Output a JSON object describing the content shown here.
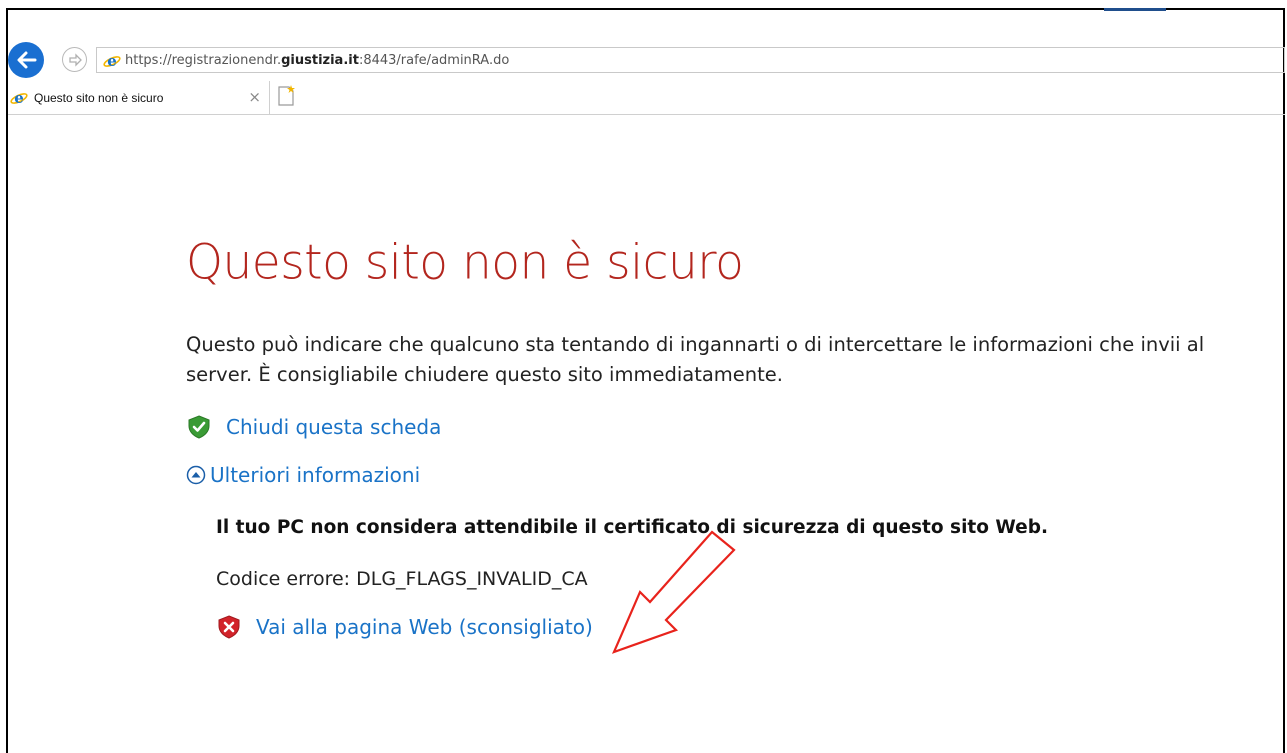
{
  "browser": {
    "address_url_prefix": "https://registrazionendr.",
    "address_url_domain": "giustizia.it",
    "address_url_suffix": ":8443/rafe/adminRA.do",
    "tab_title": "Questo sito non è sicuro",
    "tab_close": "×",
    "icons": {
      "back": "back-arrow-icon",
      "forward": "forward-arrow-icon",
      "page": "ie-icon",
      "new_tab": "new-tab-icon"
    }
  },
  "page": {
    "title": "Questo sito non è sicuro",
    "description": "Questo può indicare che qualcuno sta tentando di ingannarti o di intercettare le informazioni che invii al server. È consigliabile chiudere questo sito immediatamente.",
    "close_tab_link": "Chiudi questa scheda",
    "more_info_link": "Ulteriori informazioni",
    "cert_message": "Il tuo PC non considera attendibile il certificato di sicurezza di questo sito Web.",
    "error_code": "Codice errore: DLG_FLAGS_INVALID_CA",
    "continue_link": "Vai alla pagina Web (sconsigliato)"
  },
  "colors": {
    "title": "#b3261e",
    "link": "#1a73c7",
    "annotation_arrow": "#e8231c"
  }
}
